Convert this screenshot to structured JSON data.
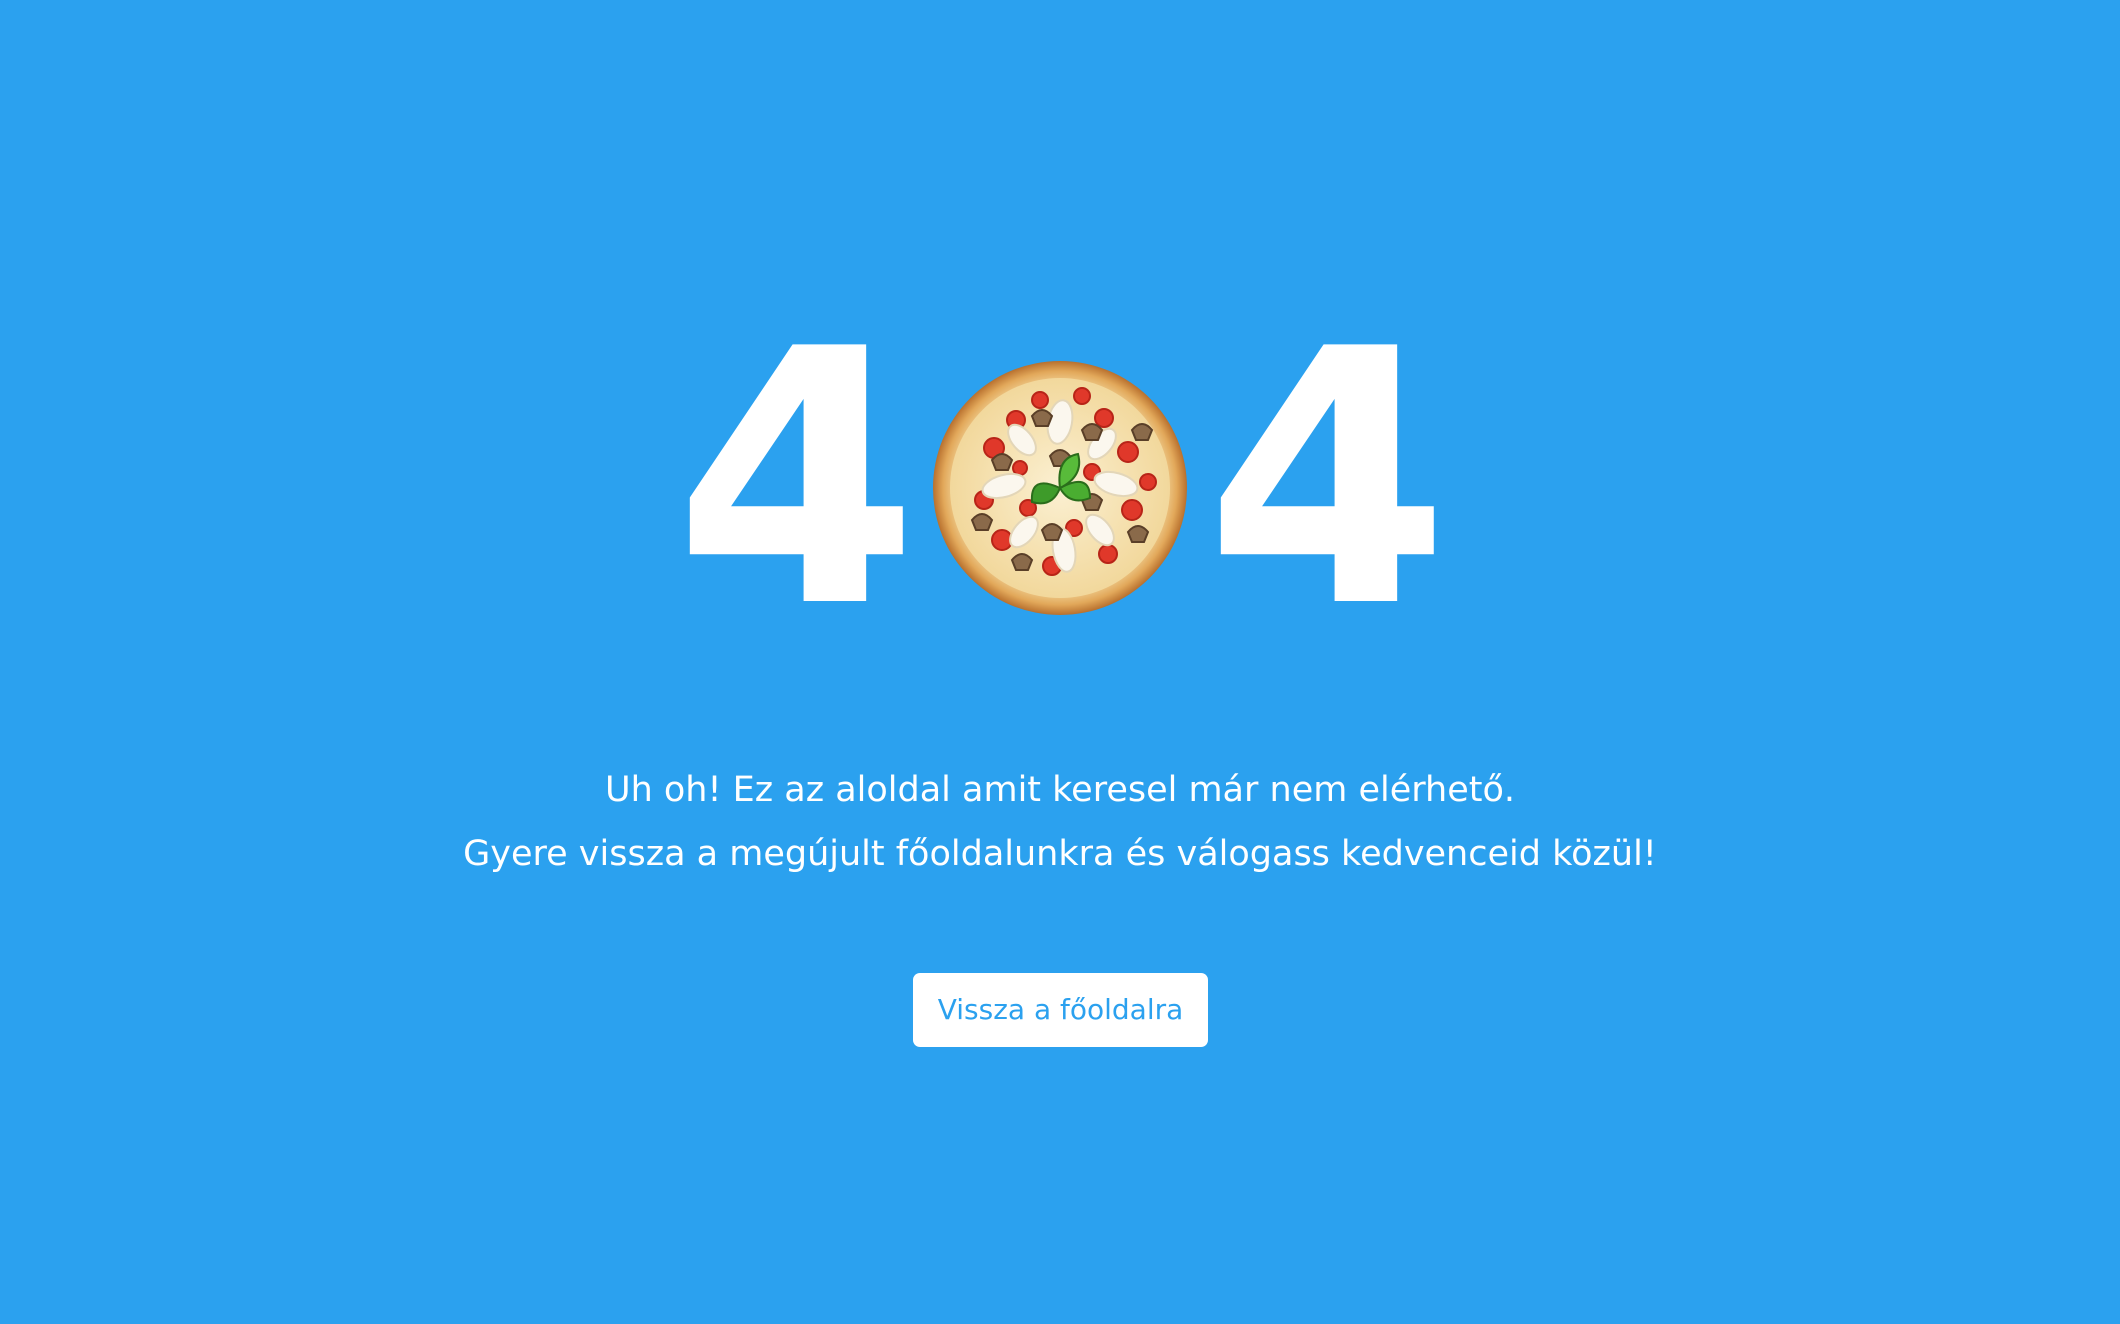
{
  "error": {
    "digit_left": "4",
    "digit_right": "4",
    "middle_image": "pizza-image"
  },
  "message": {
    "line1": "Uh oh! Ez az aloldal amit keresel már nem elérhető.",
    "line2": "Gyere vissza a megújult főoldalunkra és válogass kedvenceid közül!"
  },
  "actions": {
    "home_button_label": "Vissza a főoldalra"
  },
  "colors": {
    "background": "#2ba1ef",
    "text": "#ffffff",
    "button_bg": "#ffffff",
    "button_text": "#2ba1ef"
  }
}
